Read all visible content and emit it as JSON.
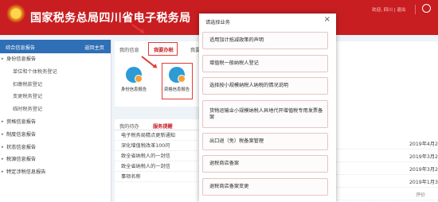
{
  "header": {
    "title": "国家税务总局四川省电子税务局",
    "user_info": "欢迎,  四川 |  退出",
    "accent": "#c81e21"
  },
  "sidebar": {
    "title": "综合信息报告",
    "back": "返回主页",
    "items": [
      {
        "label": "身份信息报告",
        "sub": false
      },
      {
        "label": "单位和个体税务登记",
        "sub": true
      },
      {
        "label": "扣缴税款登记",
        "sub": true
      },
      {
        "label": "变更税务登记",
        "sub": true
      },
      {
        "label": "临时税务登记",
        "sub": true
      },
      {
        "label": "资格信息报告",
        "sub": false
      },
      {
        "label": "制度信息报告",
        "sub": false
      },
      {
        "label": "状态信息报告",
        "sub": false
      },
      {
        "label": "税源信息报告",
        "sub": false
      },
      {
        "label": "特定涉税信息报告",
        "sub": false
      }
    ]
  },
  "tabs": {
    "my": "我的信息",
    "active": "我要办税",
    "extra": "我要"
  },
  "cards": [
    {
      "label": "身份信息报告",
      "icon": "person-info-icon"
    },
    {
      "label": "资格信息报告",
      "icon": "qualification-info-icon"
    }
  ],
  "notices": {
    "tab1": "我的待办",
    "tab2": "服务提醒",
    "rows": [
      "电子税务局精点更新通知",
      "深化增值税改革100问",
      "致全省纳税人的一封信",
      "致全省纳税人的一封信",
      "事项名称"
    ]
  },
  "right_panel": {
    "dates": [
      "2019年4月20日",
      "2019年3月26日",
      "2019年3月26日",
      "2019年1月31日"
    ],
    "head": "评价"
  },
  "dialog": {
    "title": "请选择业务",
    "close": "×",
    "options": [
      "适用加计抵减政策的声明",
      "增值税一般纳税人登记",
      "选择按小规模纳税人纳税的情况说明",
      "货物运输业小规模纳税人异地代开增值税专用发票备案",
      "出口退（免）税备案管理",
      "退税商店备案",
      "退税商店备案变更"
    ]
  }
}
